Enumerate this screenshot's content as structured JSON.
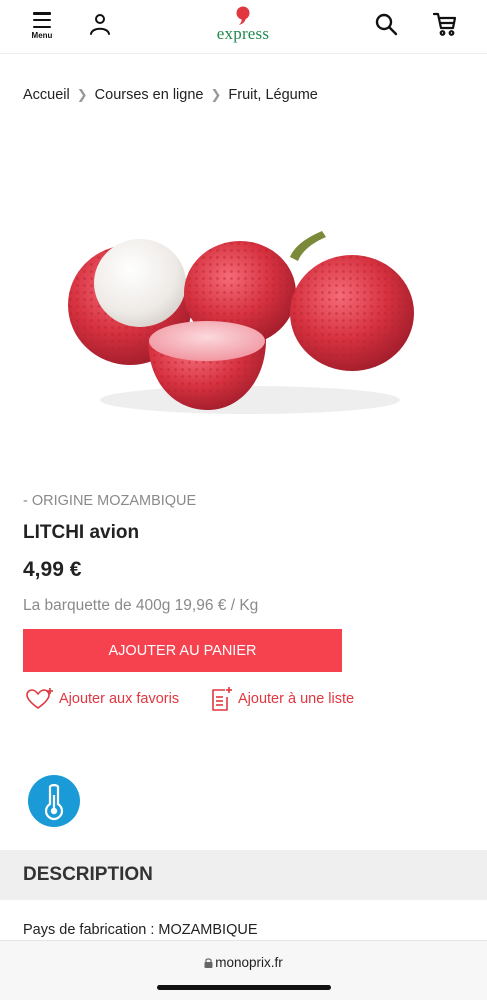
{
  "header": {
    "menu_label": "Menu",
    "logo_text": "express",
    "brand_color": "#1f8a4c",
    "logo_drop_color": "#e1373f"
  },
  "breadcrumb": {
    "items": [
      "Accueil",
      "Courses en ligne",
      "Fruit, Légume"
    ]
  },
  "product": {
    "origin": "- ORIGINE MOZAMBIQUE",
    "title": "LITCHI avion",
    "price": "4,99 €",
    "unit_price": "La barquette de 400g 19,96 € / Kg",
    "add_to_cart_label": "AJOUTER AU PANIER",
    "add_to_favorites_label": "Ajouter aux favoris",
    "add_to_list_label": "Ajouter à une liste",
    "accent_color": "#f5424e",
    "storage_icon": "thermometer-icon"
  },
  "description": {
    "header": "DESCRIPTION",
    "country_line": "Pays de fabrication : MOZAMBIQUE"
  },
  "browser": {
    "url": "monoprix.fr"
  }
}
